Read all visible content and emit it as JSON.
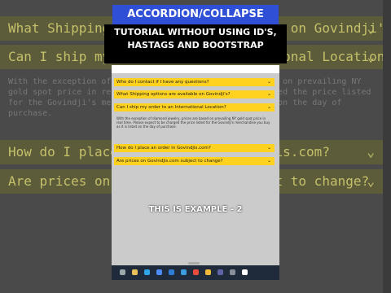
{
  "background": {
    "rows": [
      "What Shipping options are available on Govindji's?",
      "Can I ship my order to an International Location?",
      "How do I place an order in Govindjis.com?",
      "Are prices on Govindjis.com subject to change?"
    ],
    "paragraph": "With the exception of diamond jewelry, prices are based on prevailing NY gold spot price in real time. Please expect to be charged the price listed for the Govindji's merchandise you buy as it is listed on the day of purchase.",
    "chevron": "⌄"
  },
  "overlay": {
    "title": "ACCORDION/COLLAPSE",
    "subtitle_line1": "TUTORIAL WITHOUT USING ID'S,",
    "subtitle_line2": "HASTAGS AND BOOTSTRAP",
    "caption": "THIS IS EXAMPLE - 2"
  },
  "accordion": {
    "items": [
      "Who do I contact if I have any questions?",
      "What Shipping options are available on Govindji's?",
      "Can I ship my order to an International Location?",
      "How do I place an order in Govindjis.com?",
      "Are prices on Govindjis.com subject to change?"
    ],
    "open_body": "With the exception of diamond jewelry, prices are based on prevailing NY gold spot price in real time. Please expect to be charged the price listed for the Govindji's merchandise you buy as it is listed on the day of purchase.",
    "chevron": "⌄"
  },
  "colors": {
    "banner": "#2f4fd6",
    "accordion": "#ffd21f",
    "background_row": "#5d5c3a"
  },
  "taskbar": {
    "icons": [
      "search-icon",
      "file-explorer-icon",
      "edge-icon",
      "store-icon",
      "mail-icon",
      "vscode-icon",
      "chrome-icon",
      "folder-icon",
      "teams-icon",
      "settings-icon",
      "media-icon"
    ]
  }
}
